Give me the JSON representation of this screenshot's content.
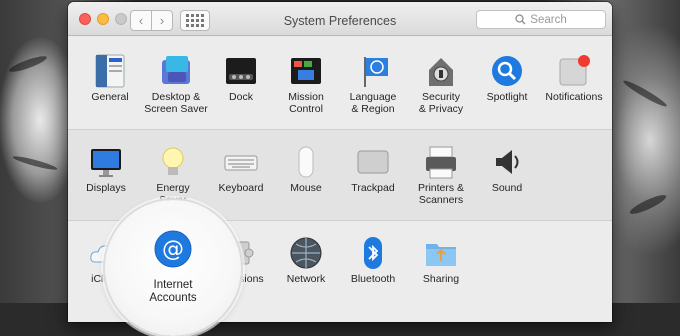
{
  "window": {
    "title": "System Preferences",
    "search_placeholder": "Search",
    "back_icon": "‹",
    "forward_icon": "›"
  },
  "section1": [
    {
      "label": "General",
      "icon": "general-icon"
    },
    {
      "label": "Desktop &\nScreen Saver",
      "icon": "desktop-icon"
    },
    {
      "label": "Dock",
      "icon": "dock-icon"
    },
    {
      "label": "Mission\nControl",
      "icon": "mission-control-icon"
    },
    {
      "label": "Language\n& Region",
      "icon": "language-region-icon"
    },
    {
      "label": "Security\n& Privacy",
      "icon": "security-icon"
    },
    {
      "label": "Spotlight",
      "icon": "spotlight-icon"
    },
    {
      "label": "Notifications",
      "icon": "notifications-icon"
    }
  ],
  "section2": [
    {
      "label": "Displays",
      "icon": "displays-icon"
    },
    {
      "label": "Energy\nSaver",
      "icon": "energy-saver-icon"
    },
    {
      "label": "Keyboard",
      "icon": "keyboard-icon"
    },
    {
      "label": "Mouse",
      "icon": "mouse-icon"
    },
    {
      "label": "Trackpad",
      "icon": "trackpad-icon"
    },
    {
      "label": "Printers &\nScanners",
      "icon": "printers-icon"
    },
    {
      "label": "Sound",
      "icon": "sound-icon"
    }
  ],
  "section3": [
    {
      "label": "iCloud",
      "icon": "icloud-icon"
    },
    {
      "label": "Extensions",
      "icon": "extensions-icon"
    },
    {
      "label": "Network",
      "icon": "network-icon"
    },
    {
      "label": "Bluetooth",
      "icon": "bluetooth-icon"
    },
    {
      "label": "Sharing",
      "icon": "sharing-icon"
    }
  ],
  "highlighted": {
    "label": "Internet\nAccounts",
    "icon": "internet-accounts-icon"
  },
  "colors": {
    "accent": "#1f7ae0",
    "window_bg": "#ececec"
  }
}
